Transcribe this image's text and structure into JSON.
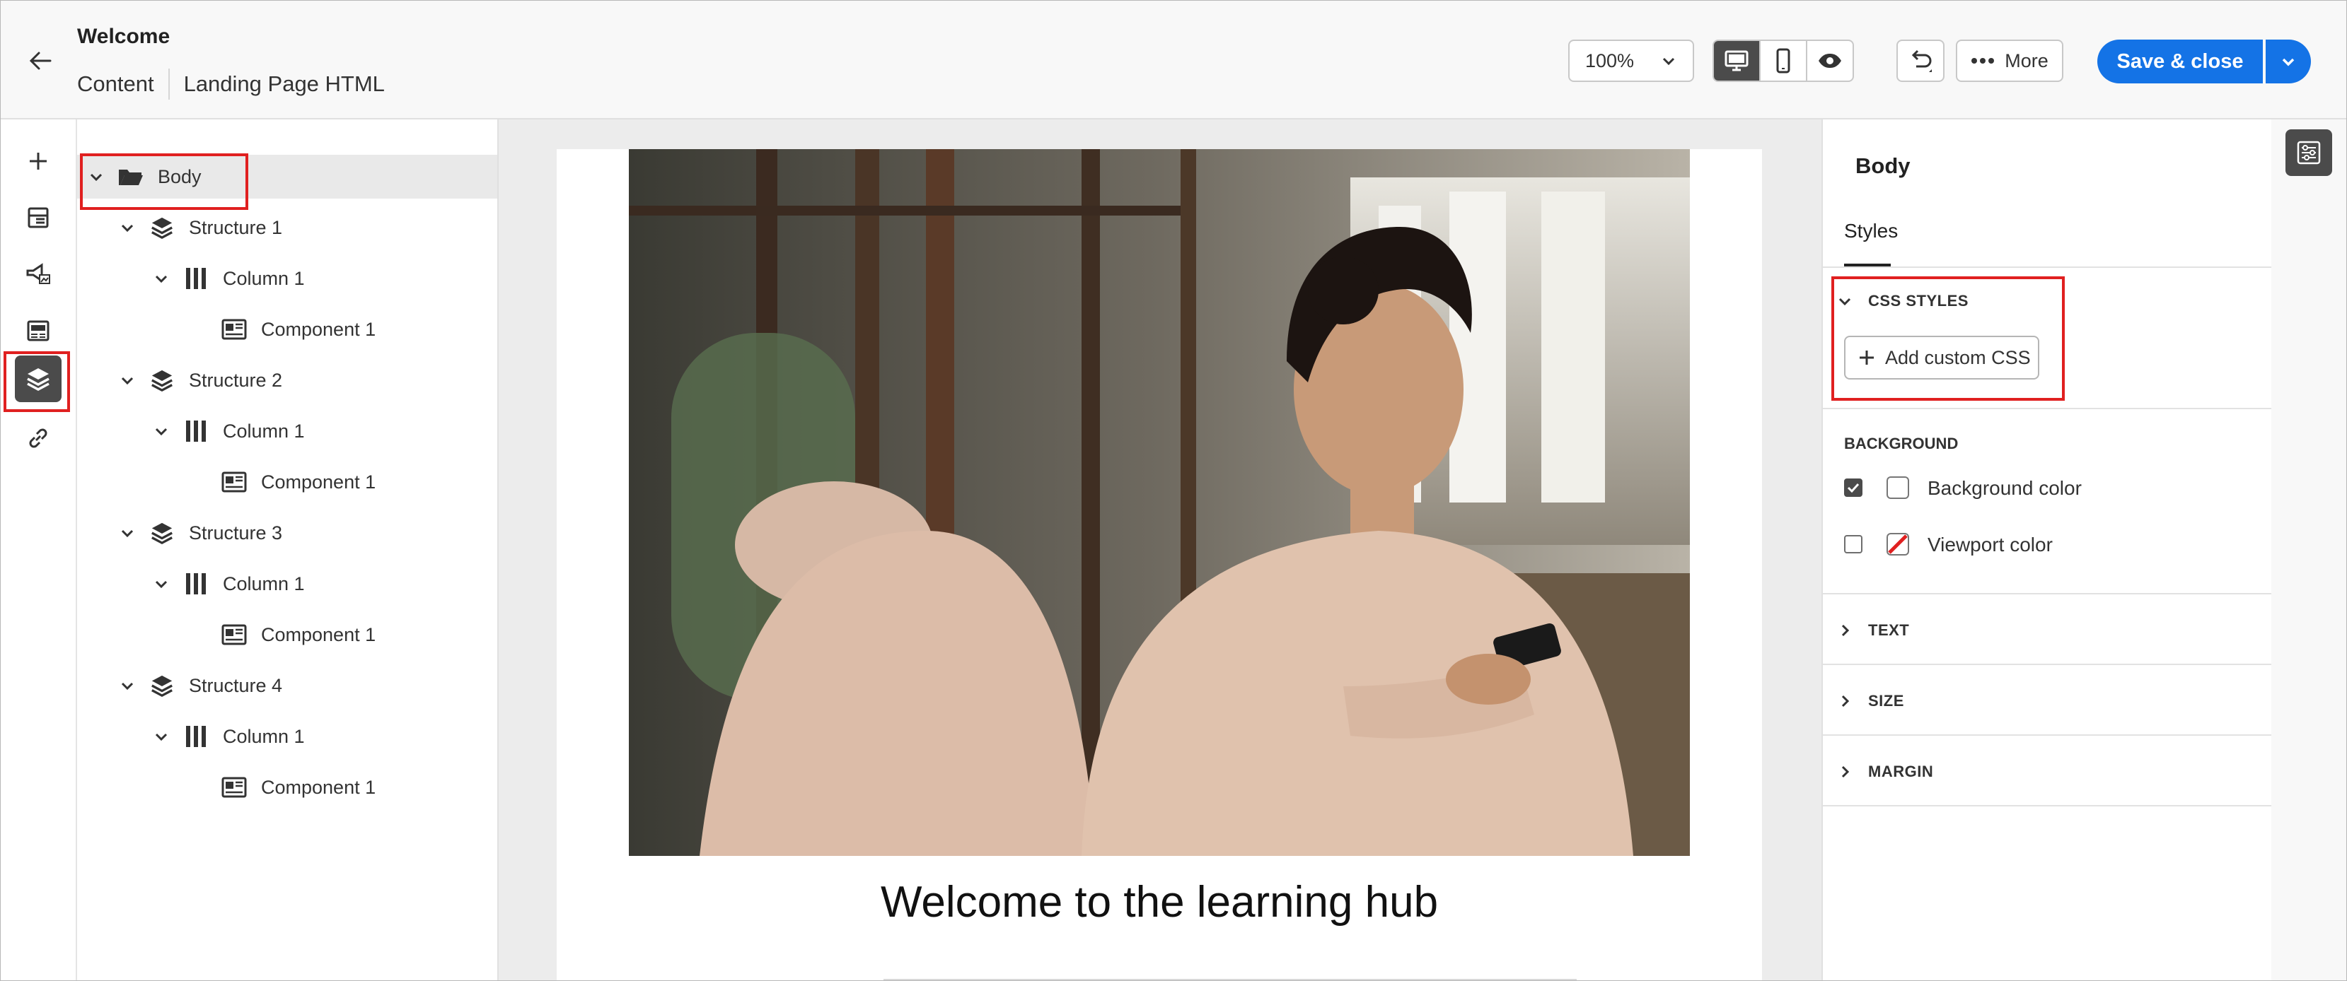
{
  "header": {
    "title": "Welcome",
    "breadcrumb_content": "Content",
    "breadcrumb_page": "Landing Page HTML",
    "zoom_value": "100%",
    "more_label": "More",
    "save_label": "Save & close"
  },
  "tree": {
    "body_label": "Body",
    "structure_1": "Structure 1",
    "structure_2": "Structure 2",
    "structure_3": "Structure 3",
    "structure_4": "Structure 4",
    "column_label": "Column 1",
    "component_label": "Component 1"
  },
  "canvas": {
    "headline": "Welcome to the learning hub"
  },
  "props": {
    "title": "Body",
    "tab_styles": "Styles",
    "section_css": "CSS STYLES",
    "add_custom_css": "Add custom CSS",
    "section_background": "BACKGROUND",
    "background_color_label": "Background color",
    "viewport_color_label": "Viewport color",
    "background_color_checked": true,
    "viewport_color_checked": false,
    "section_text": "TEXT",
    "section_size": "SIZE",
    "section_margin": "MARGIN"
  },
  "colors": {
    "accent": "#1473e6",
    "highlight_box": "#e02020",
    "active_icon_bg": "#4b4b4b"
  }
}
